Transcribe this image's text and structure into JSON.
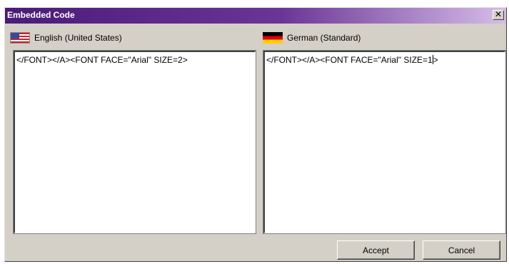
{
  "window": {
    "title": "Embedded Code",
    "close_glyph": "✕"
  },
  "source": {
    "language": "English (United States)",
    "flag_icon": "us-flag-icon",
    "text": "</FONT></A><FONT FACE=\"Arial\" SIZE=2>"
  },
  "target": {
    "language": "German (Standard)",
    "flag_icon": "de-flag-icon",
    "text_before_caret": "</FONT></A><FONT FACE=\"Arial\" SIZE=1",
    "text_after_caret": ">"
  },
  "buttons": {
    "accept": "Accept",
    "cancel": "Cancel"
  },
  "colors": {
    "title_start": "#4b1b78",
    "title_end": "#d6bde8",
    "dialog_bg": "#d4d0c8"
  }
}
